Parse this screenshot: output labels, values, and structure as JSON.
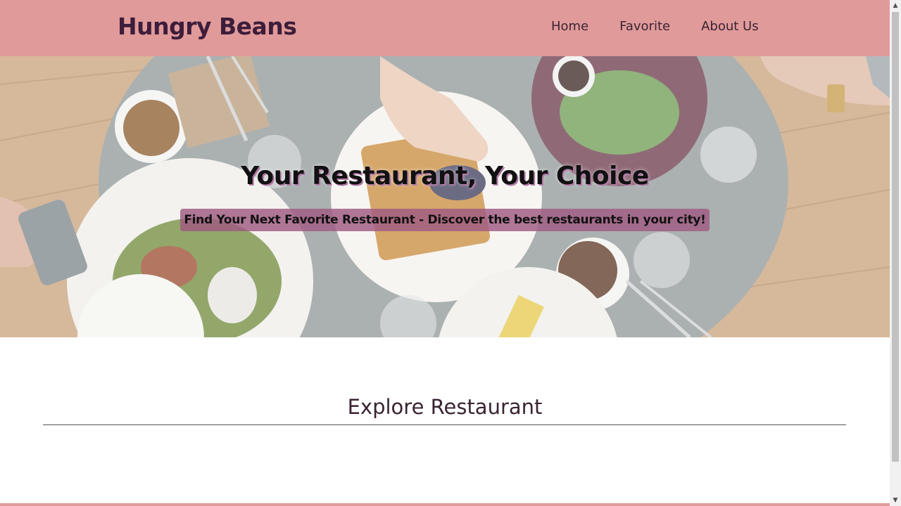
{
  "header": {
    "brand": "Hungry Beans",
    "nav": [
      "Home",
      "Favorite",
      "About Us"
    ]
  },
  "hero": {
    "title": "Your Restaurant, Your Choice",
    "subtitle": "Find Your Next Favorite Restaurant - Discover the best restaurants in your city!",
    "image": "restaurant-table-food-photo"
  },
  "explore": {
    "title": "Explore Restaurant"
  },
  "colors": {
    "header_bg": "#e09a9a",
    "brand": "#3d1d3a",
    "subtitle_bg": "#a05a82"
  },
  "scrollbar": {
    "up": "▲",
    "down": "▼"
  }
}
